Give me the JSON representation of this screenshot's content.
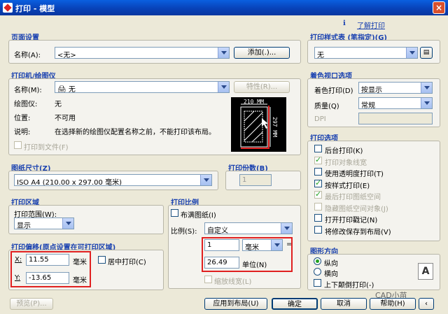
{
  "window": {
    "title": "打印 - 模型",
    "close": "×"
  },
  "help": {
    "icon": "ℹ",
    "link": "了解打印"
  },
  "page_setup": {
    "title": "页面设置",
    "name_label": "名称(A):",
    "name_value": "<无>",
    "add_button": "添加(.)..."
  },
  "printer": {
    "title": "打印机/绘图仪",
    "name_label": "名称(M):",
    "name_value": "无",
    "properties_button": "特性(R)...",
    "plotter_label": "绘图仪:",
    "plotter_value": "无",
    "location_label": "位置:",
    "location_value": "不可用",
    "desc_label": "说明:",
    "desc_value": "在选择新的绘图仪配置名称之前，不能打印该布局。",
    "print_to_file": "打印到文件(F)"
  },
  "preview": {
    "width_label": "210 MM",
    "height_label": "297 MM"
  },
  "paper_size": {
    "title": "图纸尺寸(Z)",
    "value": "ISO A4 (210.00 x 297.00 毫米)"
  },
  "copies": {
    "title": "打印份数(B)",
    "value": "1"
  },
  "plot_area": {
    "title": "打印区域",
    "range_label": "打印范围(W):",
    "range_value": "显示"
  },
  "plot_offset": {
    "title": "打印偏移(原点设置在可打印区域)",
    "x_label": "X:",
    "x_value": "11.55",
    "x_unit": "毫米",
    "y_label": "Y:",
    "y_value": "-13.65",
    "y_unit": "毫米",
    "center": "居中打印(C)"
  },
  "plot_scale": {
    "title": "打印比例",
    "fit_paper": "布满图纸(I)",
    "scale_label": "比例(S):",
    "scale_value": "自定义",
    "value1": "1",
    "unit1": "毫米",
    "eq": "=",
    "value2": "26.49",
    "unit2": "单位(N)",
    "scale_lineweights": "缩放线宽(L)"
  },
  "style_table": {
    "title": "打印样式表 (笔指定)(G)",
    "value": "无"
  },
  "shaded_viewport": {
    "title": "着色视口选项",
    "shade_label": "着色打印(D)",
    "shade_value": "按显示",
    "quality_label": "质量(Q)",
    "quality_value": "常规",
    "dpi_label": "DPI"
  },
  "plot_options": {
    "title": "打印选项",
    "items": [
      {
        "label": "后台打印(K)",
        "checked": false,
        "enabled": true
      },
      {
        "label": "打印对象线宽",
        "checked": true,
        "enabled": false
      },
      {
        "label": "使用透明度打印(T)",
        "checked": false,
        "enabled": true
      },
      {
        "label": "按样式打印(E)",
        "checked": true,
        "enabled": true
      },
      {
        "label": "最后打印图纸空间",
        "checked": true,
        "enabled": false
      },
      {
        "label": "隐藏图纸空间对象(J)",
        "checked": false,
        "enabled": false
      },
      {
        "label": "打开打印戳记(N)",
        "checked": false,
        "enabled": true
      },
      {
        "label": "将修改保存到布局(V)",
        "checked": false,
        "enabled": true
      }
    ]
  },
  "orientation": {
    "title": "图形方向",
    "portrait": "纵向",
    "landscape": "横向",
    "upside_down": "上下颠倒打印(-)"
  },
  "watermark": "CAD小苗",
  "footer": {
    "preview": "预览(P)...",
    "apply": "应用到布局(U)",
    "ok": "确定",
    "cancel": "取消",
    "help": "帮助(H)"
  }
}
